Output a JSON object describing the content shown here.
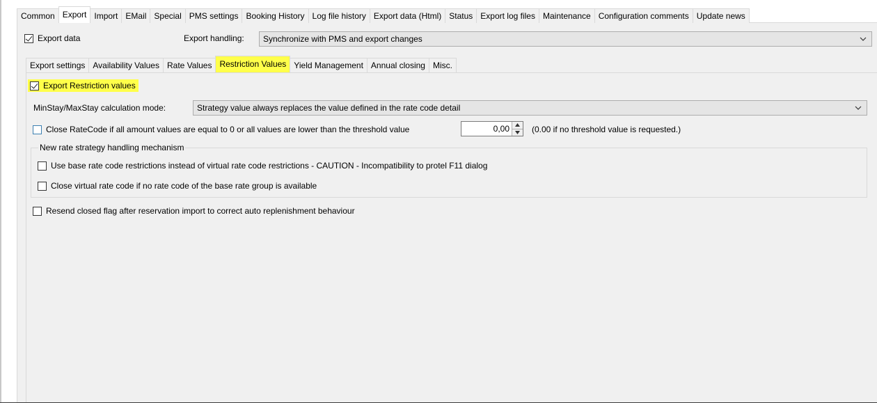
{
  "top_tabs": [
    {
      "label": "Common",
      "active": false
    },
    {
      "label": "Export",
      "active": true
    },
    {
      "label": "Import",
      "active": false
    },
    {
      "label": "EMail",
      "active": false
    },
    {
      "label": "Special",
      "active": false
    },
    {
      "label": "PMS settings",
      "active": false
    },
    {
      "label": "Booking History",
      "active": false
    },
    {
      "label": "Log file history",
      "active": false
    },
    {
      "label": "Export data (Html)",
      "active": false
    },
    {
      "label": "Status",
      "active": false
    },
    {
      "label": "Export log files",
      "active": false
    },
    {
      "label": "Maintenance",
      "active": false
    },
    {
      "label": "Configuration comments",
      "active": false
    },
    {
      "label": "Update news",
      "active": false
    }
  ],
  "export_data": {
    "label": "Export data",
    "checked": true
  },
  "export_handling": {
    "label": "Export handling:",
    "value": "Synchronize with PMS and export changes"
  },
  "inner_tabs": [
    {
      "label": "Export settings",
      "active": false
    },
    {
      "label": "Availability Values",
      "active": false
    },
    {
      "label": "Rate Values",
      "active": false
    },
    {
      "label": "Restriction Values",
      "active": true
    },
    {
      "label": "Yield Management",
      "active": false
    },
    {
      "label": "Annual closing",
      "active": false
    },
    {
      "label": "Misc.",
      "active": false
    }
  ],
  "restriction": {
    "export_restriction": {
      "label": "Export Restriction values",
      "checked": true
    },
    "minstay_mode": {
      "label": "MinStay/MaxStay calculation mode:",
      "value": "Strategy value always replaces the value defined in the rate code detail"
    },
    "close_ratecode": {
      "label": "Close RateCode if all amount values are equal to 0 or all values are lower than the threshold value",
      "checked": false
    },
    "threshold": {
      "value": "0,00",
      "hint": "(0.00 if no threshold value is requested.)"
    },
    "strategy_group": {
      "title": "New rate strategy handling mechanism",
      "base_restrictions": {
        "label": "Use base rate code restrictions instead of virtual rate code restrictions - CAUTION - Incompatibility to protel F11 dialog",
        "checked": false
      },
      "close_virtual": {
        "label": "Close virtual rate code if no rate code of the base rate group is available",
        "checked": false
      }
    },
    "resend_closed": {
      "label": "Resend closed flag after reservation import to correct auto replenishment behaviour",
      "checked": false
    }
  },
  "colors": {
    "highlight": "#ffff4a",
    "panel": "#f0f0f0"
  }
}
